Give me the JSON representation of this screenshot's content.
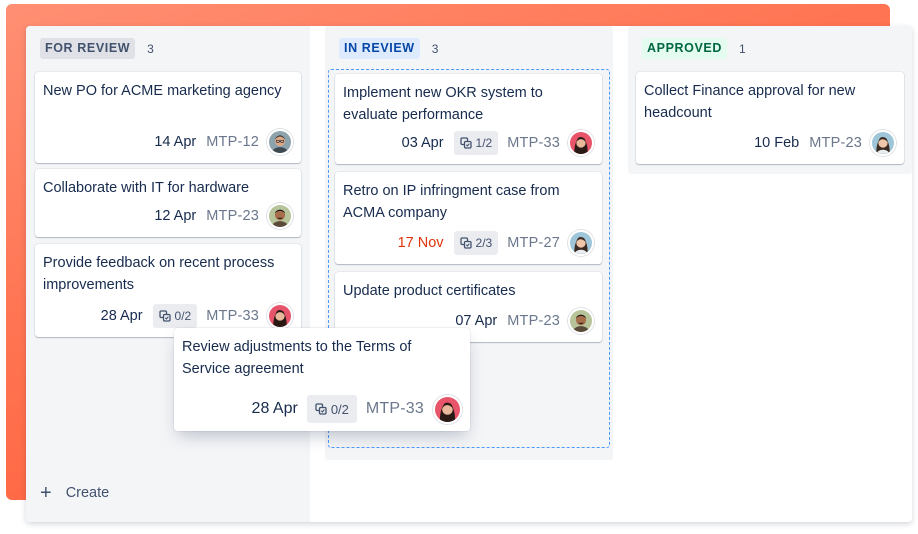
{
  "colors": {
    "accent_gradient": [
      "#ff8f73",
      "#ff5630"
    ],
    "for_review_lozenge_bg": "#dfe1e6",
    "for_review_lozenge_fg": "#42526e",
    "in_review_lozenge_bg": "#deebff",
    "in_review_lozenge_fg": "#0747a6",
    "approved_lozenge_bg": "#e3fcef",
    "approved_lozenge_fg": "#006644",
    "overdue": "#de350b",
    "dropzone_border": "#4c9aff"
  },
  "columns": [
    {
      "label": "FOR REVIEW",
      "count": "3",
      "cards": [
        {
          "title": "New PO for ACME marketing agency",
          "date": "14 Apr",
          "key": "MTP-12",
          "avatar": "avatar-man-glasses"
        },
        {
          "title": "Collaborate with IT for hardware",
          "date": "12 Apr",
          "key": "MTP-23",
          "avatar": "avatar-man-dark"
        },
        {
          "title": "Provide feedback on recent process improvements",
          "date": "28 Apr",
          "subtasks": "0/2",
          "key": "MTP-33",
          "avatar": "avatar-woman-red"
        }
      ],
      "create_label": "Create"
    },
    {
      "label": "IN REVIEW",
      "count": "3",
      "cards": [
        {
          "title": "Implement new OKR system to evaluate performance",
          "date": "03 Apr",
          "subtasks": "1/2",
          "key": "MTP-33",
          "avatar": "avatar-woman-red"
        },
        {
          "title": "Retro on IP infringment case from ACMA company",
          "date": "17 Nov",
          "date_overdue": true,
          "subtasks": "2/3",
          "key": "MTP-27",
          "avatar": "avatar-woman-blue"
        },
        {
          "title": "Update product certificates",
          "date": "07 Apr",
          "key": "MTP-23",
          "avatar": "avatar-man-dark"
        }
      ]
    },
    {
      "label": "APPROVED",
      "count": "1",
      "cards": [
        {
          "title": "Collect Finance approval for new headcount",
          "date": "10 Feb",
          "key": "MTP-23",
          "avatar": "avatar-woman-blue"
        }
      ]
    }
  ],
  "dragging_card": {
    "title": "Review adjustments to the Terms of Service agreement",
    "date": "28 Apr",
    "subtasks": "0/2",
    "key": "MTP-33",
    "avatar": "avatar-woman-red"
  }
}
